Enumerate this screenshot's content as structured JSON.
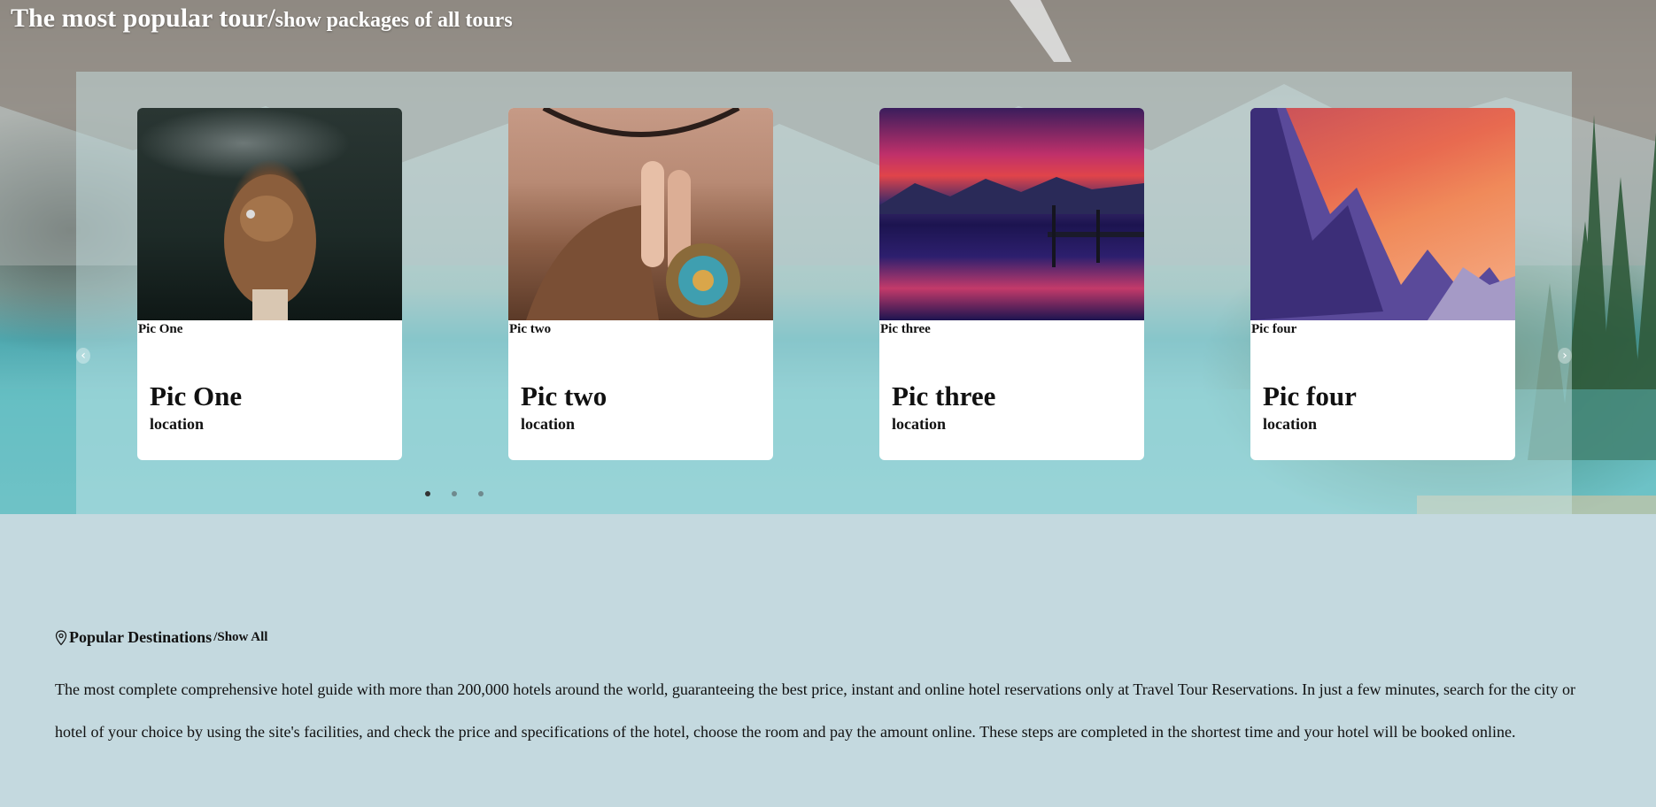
{
  "hero": {
    "title_main": "The most popular tour/",
    "title_sub": "show packages of all tours"
  },
  "carousel": {
    "prev_icon": "chevron-left-icon",
    "next_icon": "chevron-right-icon",
    "cards": [
      {
        "caption": "Pic One",
        "title": "Pic One",
        "location": "location"
      },
      {
        "caption": "Pic two",
        "title": "Pic two",
        "location": "location"
      },
      {
        "caption": "Pic three",
        "title": "Pic three",
        "location": "location"
      },
      {
        "caption": "Pic four",
        "title": "Pic four",
        "location": "location"
      }
    ],
    "dots": 3,
    "active_dot": 0
  },
  "destinations": {
    "icon": "map-pin-icon",
    "heading": "Popular Destinations",
    "show_all": "/Show All",
    "description": "The most complete comprehensive hotel guide with more than 200,000 hotels around the world, guaranteeing the best price, instant and online hotel reservations only at Travel Tour Reservations. In just a few minutes, search for the city or hotel of your choice by using the site's facilities, and check the price and specifications of the hotel, choose the room and pay the amount online. These steps are completed in the shortest time and your hotel will be booked online."
  },
  "colors": {
    "page_background": "#c4d9df",
    "card_background": "#ffffff",
    "title_text": "#ffffff"
  }
}
